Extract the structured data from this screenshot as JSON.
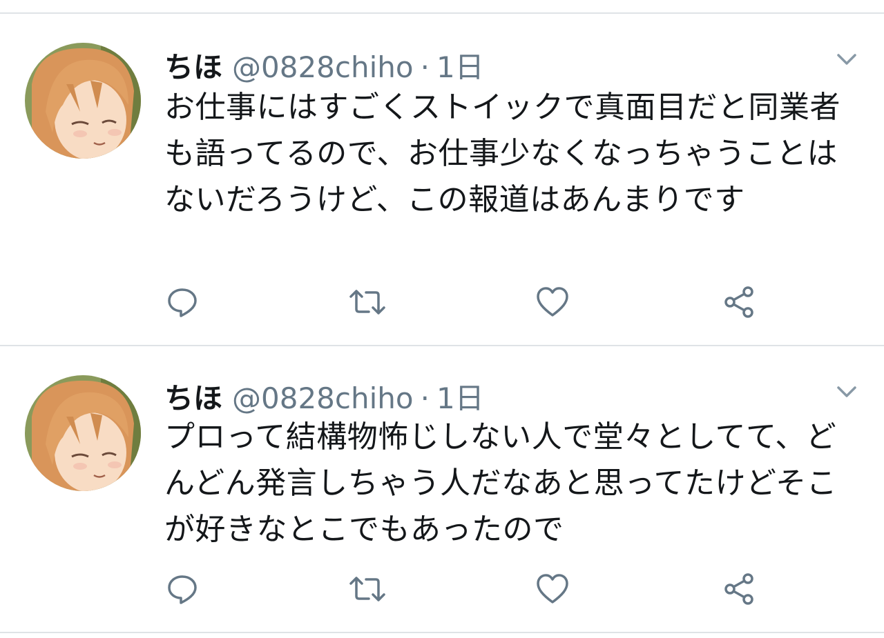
{
  "tweets": [
    {
      "name": "ちほ",
      "handle": "@0828chiho",
      "separator": "·",
      "time": "1日",
      "text": "お仕事にはすごくストイックで真面目だと同業者も語ってるので、お仕事少なくなっちゃうことはないだろうけど、この報道はあんまりです",
      "icons": {
        "reply": "reply-icon",
        "retweet": "retweet-icon",
        "like": "heart-icon",
        "share": "share-icon",
        "menu": "chevron-down-icon"
      }
    },
    {
      "name": "ちほ",
      "handle": "@0828chiho",
      "separator": "·",
      "time": "1日",
      "text": "プロって結構物怖じしない人で堂々としてて、どんどん発言しちゃう人だなあと思ってたけどそこが好きなとこでもあったので",
      "icons": {
        "reply": "reply-icon",
        "retweet": "retweet-icon",
        "like": "heart-icon",
        "share": "share-icon",
        "menu": "chevron-down-icon"
      }
    }
  ],
  "colors": {
    "text": "#14171a",
    "secondary": "#657786",
    "divider": "#dfe3e6"
  }
}
